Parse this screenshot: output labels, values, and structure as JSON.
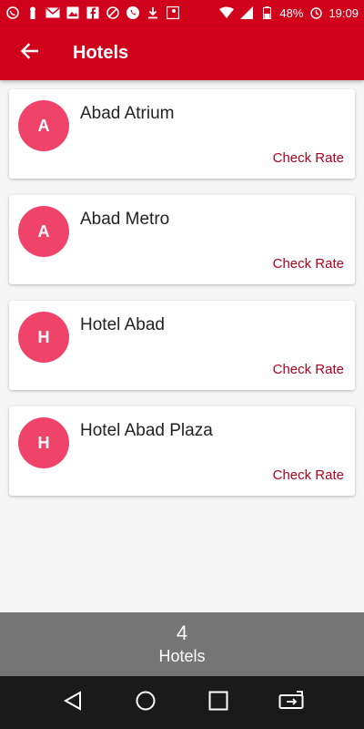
{
  "status_bar": {
    "battery": "48%",
    "time": "19:09"
  },
  "app_bar": {
    "title": "Hotels"
  },
  "hotels": [
    {
      "initial": "A",
      "name": "Abad Atrium",
      "action": "Check Rate"
    },
    {
      "initial": "A",
      "name": "Abad Metro",
      "action": "Check Rate"
    },
    {
      "initial": "H",
      "name": "Hotel Abad",
      "action": "Check Rate"
    },
    {
      "initial": "H",
      "name": "Hotel Abad Plaza",
      "action": "Check Rate"
    }
  ],
  "footer": {
    "count": "4",
    "label": "Hotels"
  },
  "colors": {
    "primary": "#d0021b",
    "avatar": "#f0436a",
    "action": "#b00020",
    "footer": "#757575"
  }
}
